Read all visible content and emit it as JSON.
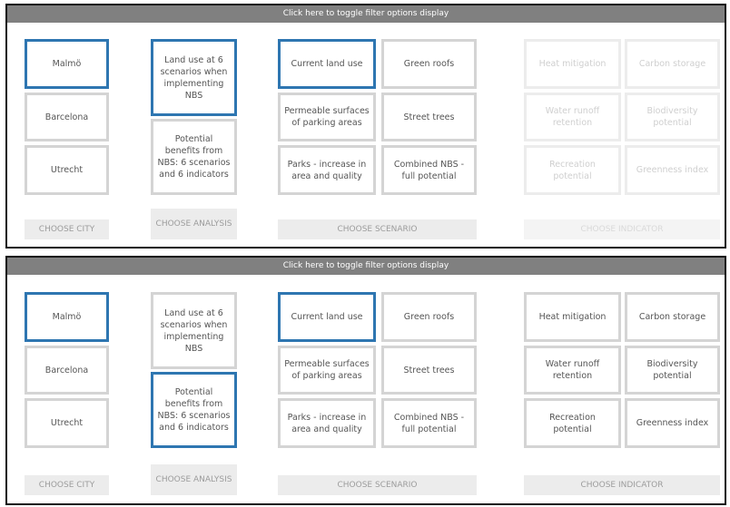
{
  "toggle_bar_label": "Click here to toggle filter options display",
  "cities": [
    "Malmö",
    "Barcelona",
    "Utrecht"
  ],
  "analyses": [
    "Land use at 6 scenarios when implementing NBS",
    "Potential benefits from NBS: 6 scenarios and 6 indicators"
  ],
  "scenarios": [
    "Current land use",
    "Green roofs",
    "Permeable surfaces of parking areas",
    "Street trees",
    "Parks - increase in area and quality",
    "Combined NBS - full potential"
  ],
  "indicators": [
    "Heat mitigation",
    "Carbon storage",
    "Water runoff retention",
    "Biodiversity potential",
    "Recreation potential",
    "Greenness index"
  ],
  "choose_labels": {
    "city": "CHOOSE CITY",
    "analysis": "CHOOSE ANALYSIS",
    "scenario": "CHOOSE SCENARIO",
    "indicator": "CHOOSE INDICATOR"
  },
  "panels": [
    {
      "selected_city": "Malmö",
      "selected_analysis": "Land use at 6 scenarios when implementing NBS",
      "selected_scenario": "Current land use",
      "indicators_enabled": false
    },
    {
      "selected_city": "Malmö",
      "selected_analysis": "Potential benefits from NBS: 6 scenarios and 6 indicators",
      "selected_scenario": "Current land use",
      "indicators_enabled": true
    }
  ],
  "colors": {
    "selected_border": "#2e76b1",
    "toggle_bar": "#808080",
    "tile_border": "#d4d4d4"
  }
}
